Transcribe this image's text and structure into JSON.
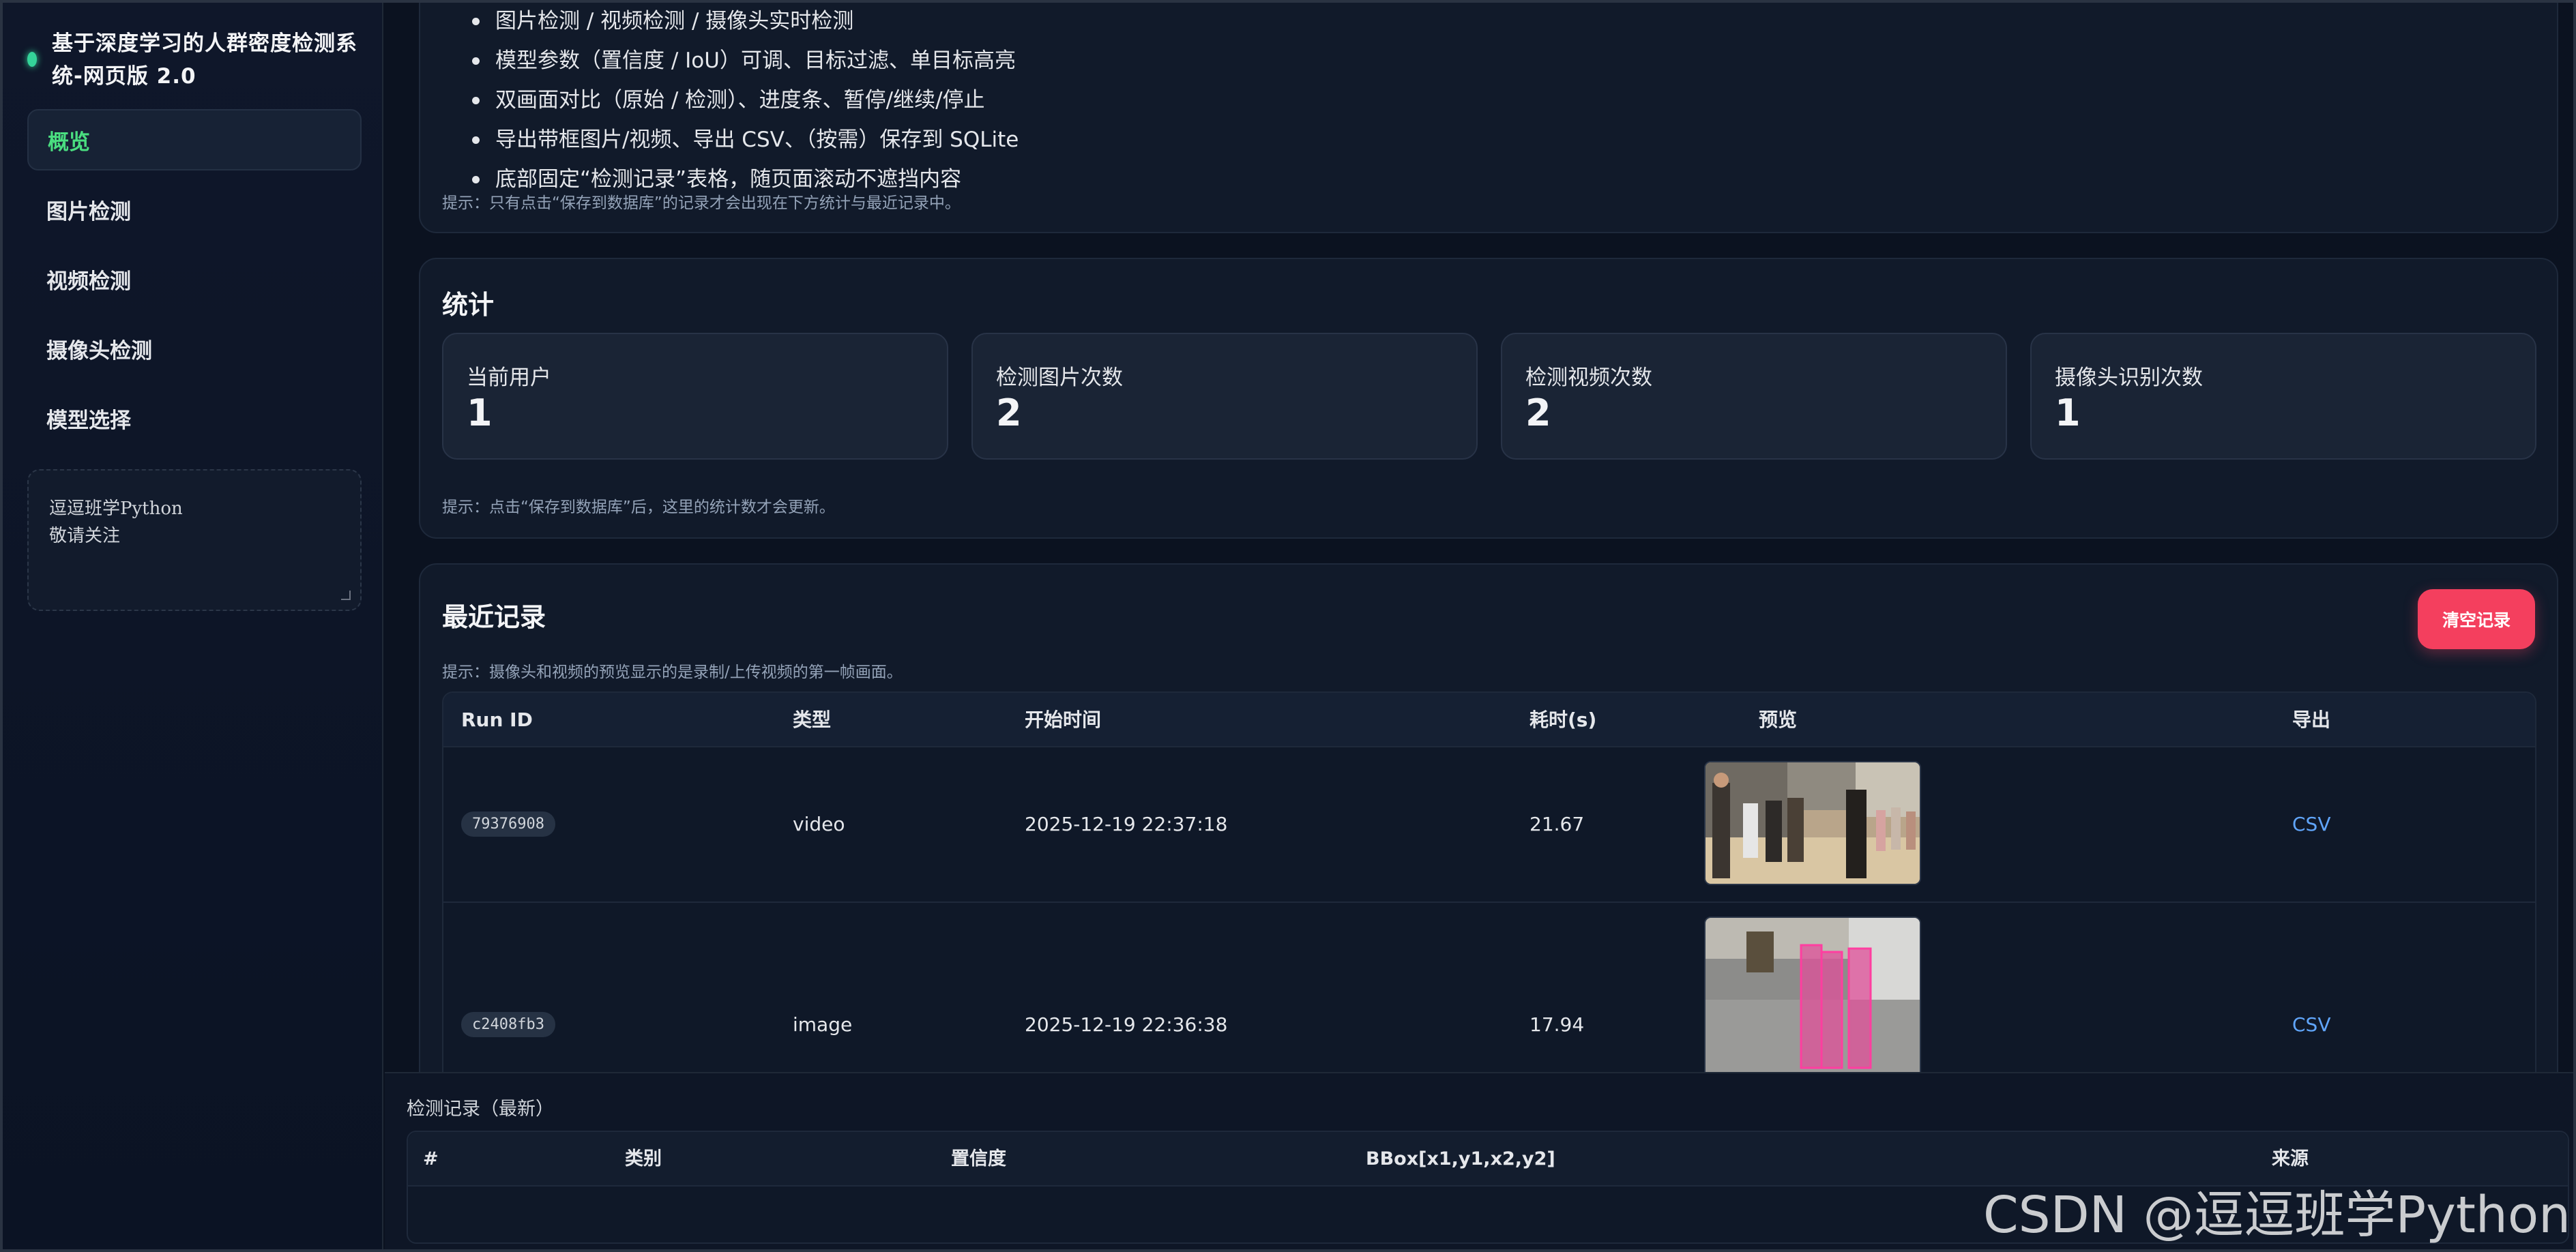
{
  "sidebar": {
    "title": "基于深度学习的人群密度检测系统-网页版 2.0",
    "nav": [
      {
        "label": "概览",
        "active": true
      },
      {
        "label": "图片检测",
        "active": false
      },
      {
        "label": "视频检测",
        "active": false
      },
      {
        "label": "摄像头检测",
        "active": false
      },
      {
        "label": "模型选择",
        "active": false
      }
    ],
    "note": "逗逗班学Python\n敬请关注"
  },
  "features": {
    "items": [
      "图片检测 / 视频检测 / 摄像头实时检测",
      "模型参数（置信度 / IoU）可调、目标过滤、单目标高亮",
      "双画面对比（原始 / 检测）、进度条、暂停/继续/停止",
      "导出带框图片/视频、导出 CSV、（按需）保存到 SQLite",
      "底部固定“检测记录”表格，随页面滚动不遮挡内容"
    ],
    "hint": "提示：只有点击“保存到数据库”的记录才会出现在下方统计与最近记录中。"
  },
  "stats": {
    "title": "统计",
    "boxes": [
      {
        "label": "当前用户",
        "value": "1"
      },
      {
        "label": "检测图片次数",
        "value": "2"
      },
      {
        "label": "检测视频次数",
        "value": "2"
      },
      {
        "label": "摄像头识别次数",
        "value": "1"
      }
    ],
    "hint": "提示：点击“保存到数据库”后，这里的统计数才会更新。"
  },
  "recent": {
    "title": "最近记录",
    "clear_label": "清空记录",
    "hint": "提示：摄像头和视频的预览显示的是录制/上传视频的第一帧画面。",
    "columns": [
      "Run ID",
      "类型",
      "开始时间",
      "耗时(s)",
      "预览",
      "导出"
    ],
    "rows": [
      {
        "run_id": "79376908",
        "type": "video",
        "start": "2025-12-19 22:37:18",
        "duration": "21.67",
        "export": "CSV"
      },
      {
        "run_id": "c2408fb3",
        "type": "image",
        "start": "2025-12-19 22:36:38",
        "duration": "17.94",
        "export": "CSV"
      }
    ]
  },
  "bottom": {
    "title": "检测记录（最新）",
    "columns": [
      "#",
      "类别",
      "置信度",
      "BBox[x1,y1,x2,y2]",
      "来源"
    ]
  },
  "watermark": "CSDN @逗逗班学Python",
  "colors": {
    "accent": "#4ade80",
    "danger": "#f43f5e",
    "link": "#60a5fa",
    "bg": "#0b1220"
  }
}
